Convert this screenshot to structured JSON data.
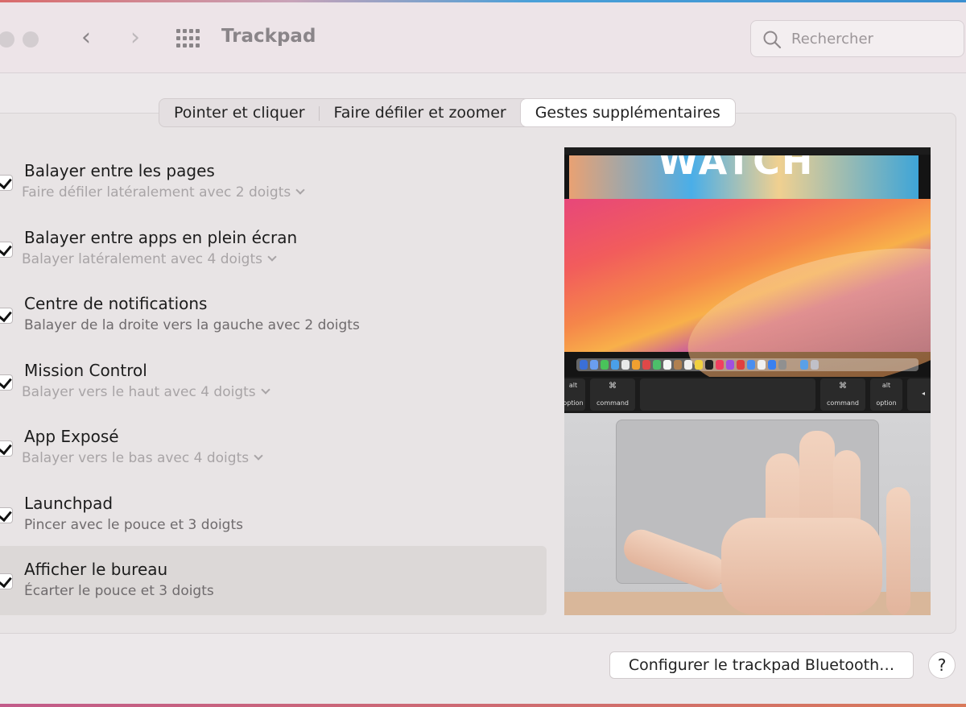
{
  "window": {
    "title": "Trackpad",
    "back_glyph": "‹",
    "forward_glyph": "›"
  },
  "search": {
    "placeholder": "Rechercher"
  },
  "tabs": [
    {
      "label": "Pointer et cliquer",
      "active": false
    },
    {
      "label": "Faire défiler et zoomer",
      "active": false
    },
    {
      "label": "Gestes supplémentaires",
      "active": true
    }
  ],
  "gestures": [
    {
      "title": "Balayer entre les pages",
      "subtitle": "Faire défiler latéralement avec 2 doigts",
      "checked": true,
      "has_menu": true
    },
    {
      "title": "Balayer entre apps en plein écran",
      "subtitle": "Balayer latéralement avec 4 doigts",
      "checked": true,
      "has_menu": true
    },
    {
      "title": "Centre de notifications",
      "subtitle": "Balayer de la droite vers la gauche avec 2 doigts",
      "checked": true,
      "has_menu": false
    },
    {
      "title": "Mission Control",
      "subtitle": "Balayer vers le haut avec 4 doigts",
      "checked": true,
      "has_menu": true
    },
    {
      "title": "App Exposé",
      "subtitle": "Balayer vers le bas avec 4 doigts",
      "checked": true,
      "has_menu": true
    },
    {
      "title": "Launchpad",
      "subtitle": "Pincer avec le pouce et 3 doigts",
      "checked": true,
      "has_menu": false
    },
    {
      "title": "Afficher le bureau",
      "subtitle": "Écarter le pouce et 3 doigts",
      "checked": true,
      "has_menu": false,
      "selected": true
    }
  ],
  "preview": {
    "banner_text": "WATCH",
    "keys": {
      "alt": "alt",
      "option": "option",
      "cmd_symbol": "⌘",
      "command": "command",
      "arrow": "◂"
    }
  },
  "footer": {
    "configure_label": "Configurer le trackpad Bluetooth…",
    "help_label": "?"
  },
  "colors": {
    "accent": "#3b8fd0",
    "panel_bg": "#e8e4e5",
    "titlebar_bg": "#ede4e8"
  }
}
